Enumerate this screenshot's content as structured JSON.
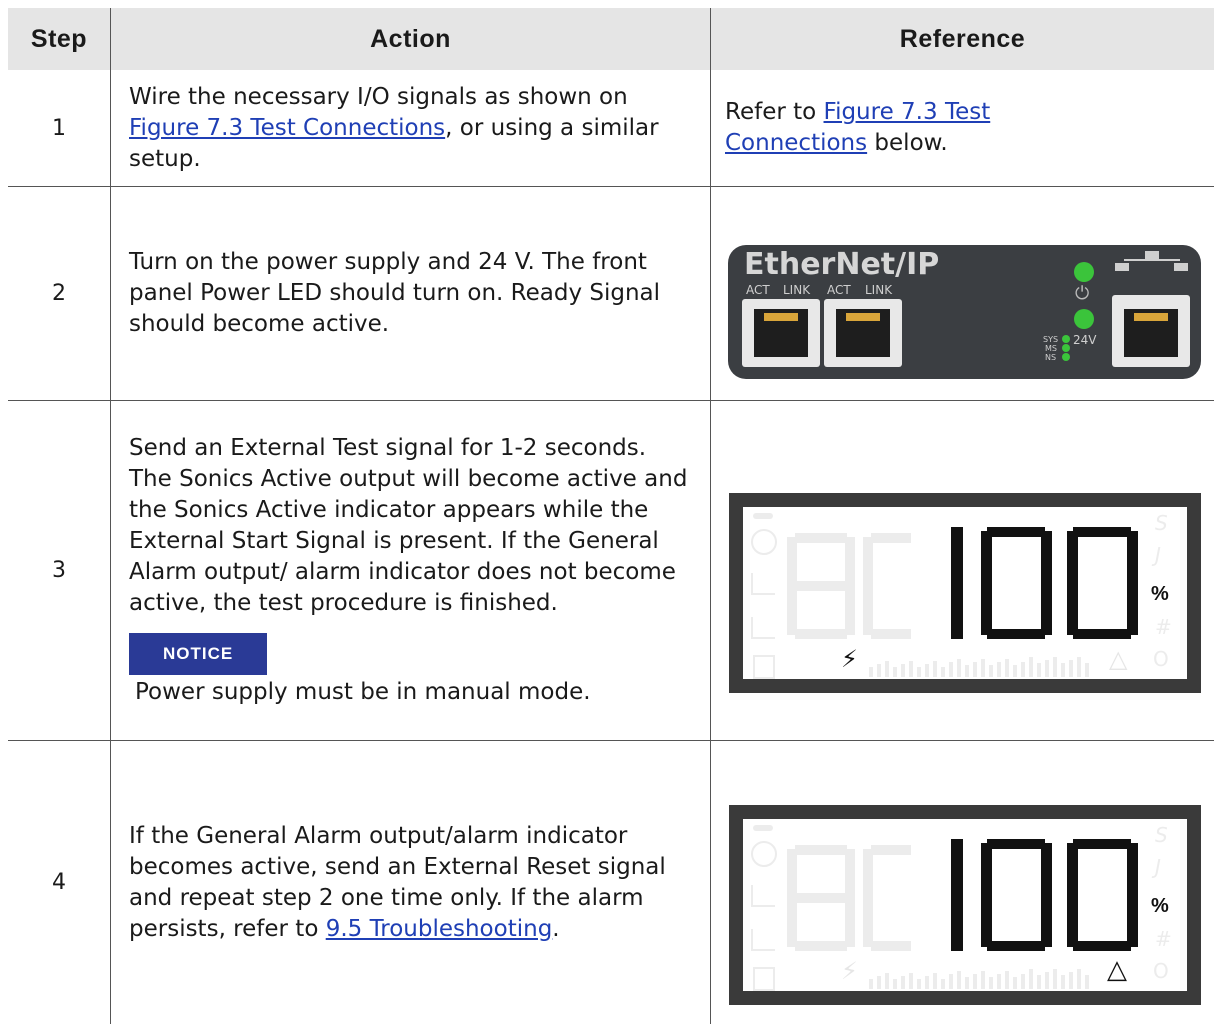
{
  "headers": {
    "step": "Step",
    "action": "Action",
    "reference": "Reference"
  },
  "rows": [
    {
      "step": "1",
      "action_pre": "Wire the necessary I/O signals as shown on ",
      "action_link": "Figure 7.3 Test Connections",
      "action_post": ", or using a similar setup.",
      "ref_pre": "Refer to ",
      "ref_link": "Figure 7.3 Test Connections",
      "ref_post": " below."
    },
    {
      "step": "2",
      "action": "Turn on the power supply and 24 V. The front panel Power LED should turn on. Ready Signal should become active."
    },
    {
      "step": "3",
      "action": "Send an External Test signal for 1-2 seconds. The Sonics Active output will become active and the Sonics Active indicator appears while the External Start Signal is present. If the General Alarm output/ alarm indicator does not become active, the test procedure is finished.",
      "notice_label": "NOTICE",
      "notice_text": "Power supply must be in manual mode."
    },
    {
      "step": "4",
      "action_pre": "If the General Alarm output/alarm indicator becomes active, send an External Reset signal and repeat step 2 one time only. If the alarm persists, refer to ",
      "action_link": "9.5 Troubleshooting",
      "action_post": "."
    }
  ],
  "ethernet_panel": {
    "title": "EtherNet/IP",
    "port_labels": [
      "ACT",
      "LINK",
      "ACT",
      "LINK"
    ],
    "led_labels": [
      "SYS",
      "MS",
      "NS"
    ],
    "voltage_label": "24V",
    "power_symbol": "⏻"
  },
  "lcd_display": {
    "value": "100",
    "unit": "%",
    "side_letters": [
      "S",
      "J",
      "#",
      "O"
    ],
    "lightning_symbol": "⚡",
    "bell_symbol": "🔔"
  }
}
